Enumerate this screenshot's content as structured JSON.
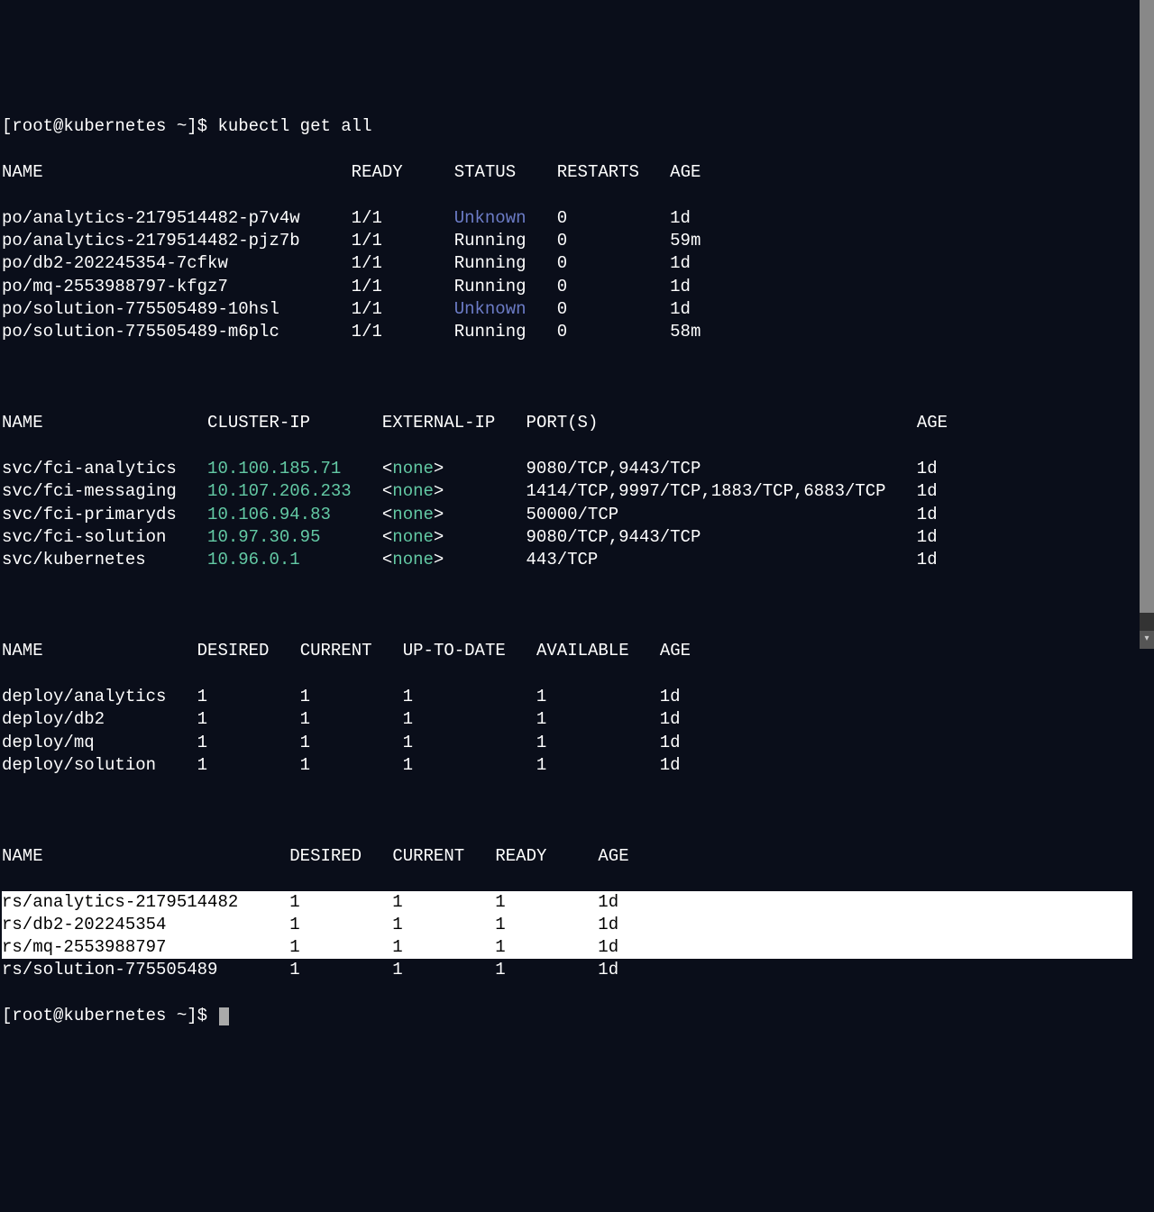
{
  "prompt": "[root@kubernetes ~]$ ",
  "command": "kubectl get all",
  "pods": {
    "header": {
      "name": "NAME",
      "ready": "READY",
      "status": "STATUS",
      "restarts": "RESTARTS",
      "age": "AGE"
    },
    "rows": [
      {
        "name": "po/analytics-2179514482-p7v4w",
        "ready": "1/1",
        "status": "Unknown",
        "status_color": "blue",
        "restarts": "0",
        "age": "1d"
      },
      {
        "name": "po/analytics-2179514482-pjz7b",
        "ready": "1/1",
        "status": "Running",
        "status_color": "white",
        "restarts": "0",
        "age": "59m"
      },
      {
        "name": "po/db2-202245354-7cfkw",
        "ready": "1/1",
        "status": "Running",
        "status_color": "white",
        "restarts": "0",
        "age": "1d"
      },
      {
        "name": "po/mq-2553988797-kfgz7",
        "ready": "1/1",
        "status": "Running",
        "status_color": "white",
        "restarts": "0",
        "age": "1d"
      },
      {
        "name": "po/solution-775505489-10hsl",
        "ready": "1/1",
        "status": "Unknown",
        "status_color": "blue",
        "restarts": "0",
        "age": "1d"
      },
      {
        "name": "po/solution-775505489-m6plc",
        "ready": "1/1",
        "status": "Running",
        "status_color": "white",
        "restarts": "0",
        "age": "58m"
      }
    ]
  },
  "svc": {
    "header": {
      "name": "NAME",
      "clusterip": "CLUSTER-IP",
      "externalip": "EXTERNAL-IP",
      "ports": "PORT(S)",
      "age": "AGE"
    },
    "rows": [
      {
        "name": "svc/fci-analytics",
        "clusterip": "10.100.185.71",
        "externalip_pre": "<",
        "externalip_none": "none",
        "externalip_post": ">",
        "ports": "9080/TCP,9443/TCP",
        "age": "1d"
      },
      {
        "name": "svc/fci-messaging",
        "clusterip": "10.107.206.233",
        "externalip_pre": "<",
        "externalip_none": "none",
        "externalip_post": ">",
        "ports": "1414/TCP,9997/TCP,1883/TCP,6883/TCP",
        "age": "1d"
      },
      {
        "name": "svc/fci-primaryds",
        "clusterip": "10.106.94.83",
        "externalip_pre": "<",
        "externalip_none": "none",
        "externalip_post": ">",
        "ports": "50000/TCP",
        "age": "1d"
      },
      {
        "name": "svc/fci-solution",
        "clusterip": "10.97.30.95",
        "externalip_pre": "<",
        "externalip_none": "none",
        "externalip_post": ">",
        "ports": "9080/TCP,9443/TCP",
        "age": "1d"
      },
      {
        "name": "svc/kubernetes",
        "clusterip": "10.96.0.1",
        "externalip_pre": "<",
        "externalip_none": "none",
        "externalip_post": ">",
        "ports": "443/TCP",
        "age": "1d"
      }
    ]
  },
  "deploy": {
    "header": {
      "name": "NAME",
      "desired": "DESIRED",
      "current": "CURRENT",
      "uptodate": "UP-TO-DATE",
      "available": "AVAILABLE",
      "age": "AGE"
    },
    "rows": [
      {
        "name": "deploy/analytics",
        "desired": "1",
        "current": "1",
        "uptodate": "1",
        "available": "1",
        "age": "1d"
      },
      {
        "name": "deploy/db2",
        "desired": "1",
        "current": "1",
        "uptodate": "1",
        "available": "1",
        "age": "1d"
      },
      {
        "name": "deploy/mq",
        "desired": "1",
        "current": "1",
        "uptodate": "1",
        "available": "1",
        "age": "1d"
      },
      {
        "name": "deploy/solution",
        "desired": "1",
        "current": "1",
        "uptodate": "1",
        "available": "1",
        "age": "1d"
      }
    ]
  },
  "rs": {
    "header": {
      "name": "NAME",
      "desired": "DESIRED",
      "current": "CURRENT",
      "ready": "READY",
      "age": "AGE"
    },
    "rows": [
      {
        "name": "rs/analytics-2179514482",
        "desired": "1",
        "current": "1",
        "ready": "1",
        "age": "1d"
      },
      {
        "name": "rs/db2-202245354",
        "desired": "1",
        "current": "1",
        "ready": "1",
        "age": "1d"
      },
      {
        "name": "rs/mq-2553988797",
        "desired": "1",
        "current": "1",
        "ready": "1",
        "age": "1d"
      },
      {
        "name": "rs/solution-775505489",
        "desired": "1",
        "current": "1",
        "ready": "1",
        "age": "1d"
      }
    ]
  }
}
